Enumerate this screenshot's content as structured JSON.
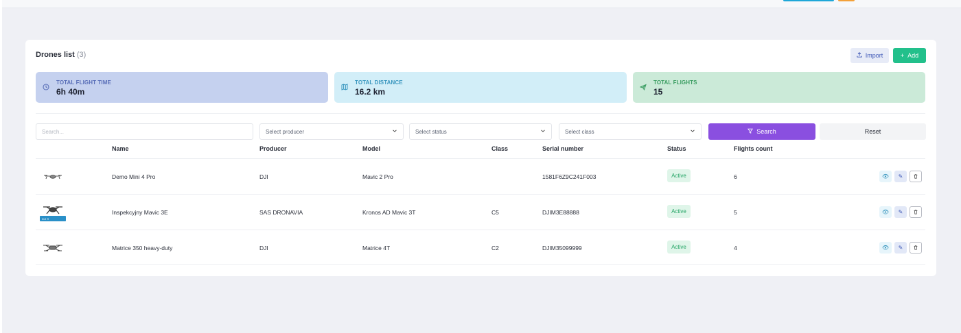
{
  "page": {
    "title": "Drones list",
    "count": "(3)",
    "import_label": "Import",
    "add_label": "Add"
  },
  "stats": [
    {
      "icon": "clock-icon",
      "label": "TOTAL FLIGHT TIME",
      "value": "6h 40m"
    },
    {
      "icon": "map-icon",
      "label": "TOTAL DISTANCE",
      "value": "16.2 km"
    },
    {
      "icon": "plane-icon",
      "label": "TOTAL FLIGHTS",
      "value": "15"
    }
  ],
  "filters": {
    "search_placeholder": "Search...",
    "producer": "Select producer",
    "status": "Select status",
    "class": "Select class",
    "search_button": "Search",
    "reset_button": "Reset"
  },
  "table": {
    "columns": [
      "Name",
      "Producer",
      "Model",
      "Class",
      "Serial number",
      "Status",
      "Flights count"
    ],
    "rows": [
      {
        "name": "Demo Mini 4 Pro",
        "producer": "DJI",
        "model": "Mavic 2 Pro",
        "class": "",
        "serial": "1581F6Z9C241F003",
        "status": "Active",
        "flights": "6"
      },
      {
        "name": "Inspekcyjny Mavic 3E",
        "producer": "SAS DRONAVIA",
        "model": "Kronos AD Mavic 3T",
        "class": "C5",
        "serial": "DJIM3E88888",
        "status": "Active",
        "flights": "5"
      },
      {
        "name": "Matrice 350 heavy-duty",
        "producer": "DJI",
        "model": "Matrice 4T",
        "class": "C2",
        "serial": "DJIM35099999",
        "status": "Active",
        "flights": "4"
      }
    ]
  },
  "colors": {
    "accent_purple": "#8a4fe0",
    "accent_green": "#22c08b",
    "status_active": "#25a566"
  }
}
